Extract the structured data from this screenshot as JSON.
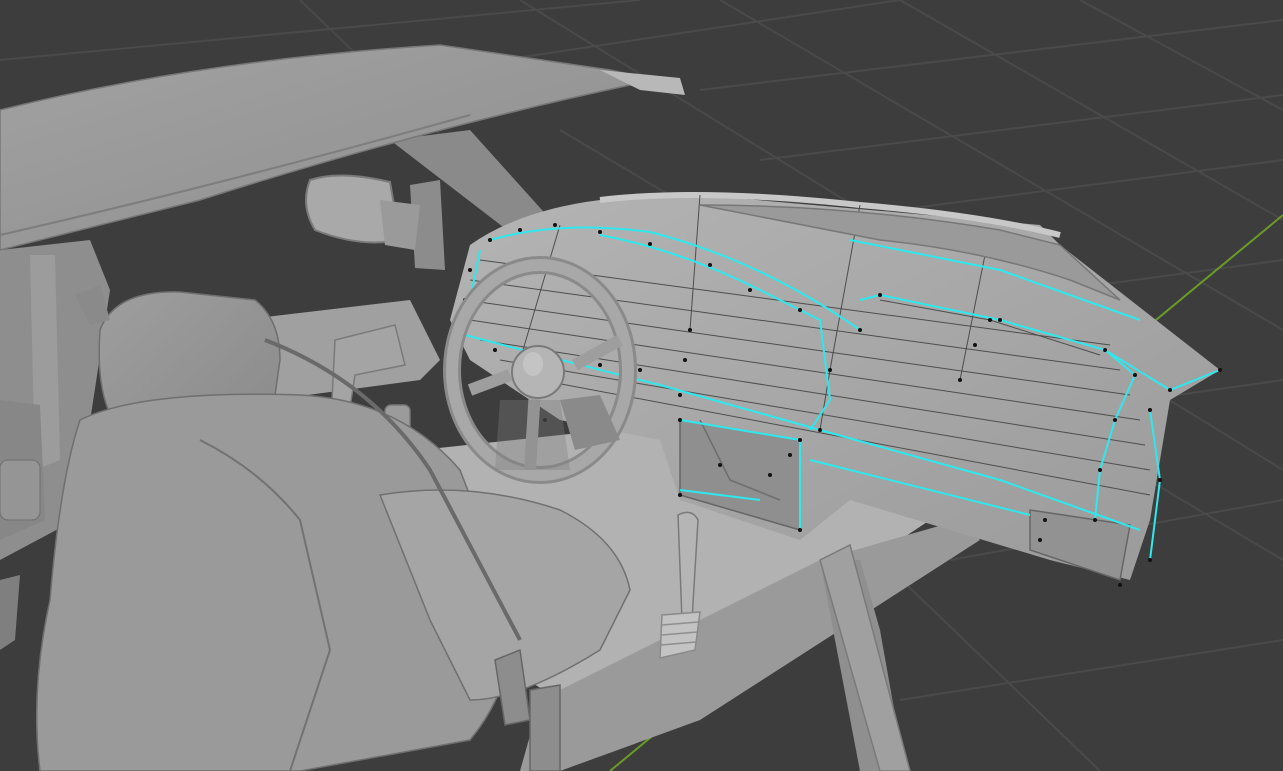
{
  "viewport": {
    "mode": "edit-mode",
    "shading": "solid",
    "background_color": "#3d3d3d",
    "grid_color": "#4a4a4a",
    "axis_x_color": "#6a9a28",
    "mesh_color": "#a6a6a6",
    "edge_seam_color": "#2fe8ee",
    "vertex_color": "#111111",
    "objects": [
      "car-roof",
      "side-mirror",
      "driver-seat",
      "seatbelt",
      "door-handle",
      "steering-wheel",
      "gear-shifter",
      "dashboard",
      "floor",
      "door-frame"
    ],
    "selected_object": "dashboard"
  }
}
